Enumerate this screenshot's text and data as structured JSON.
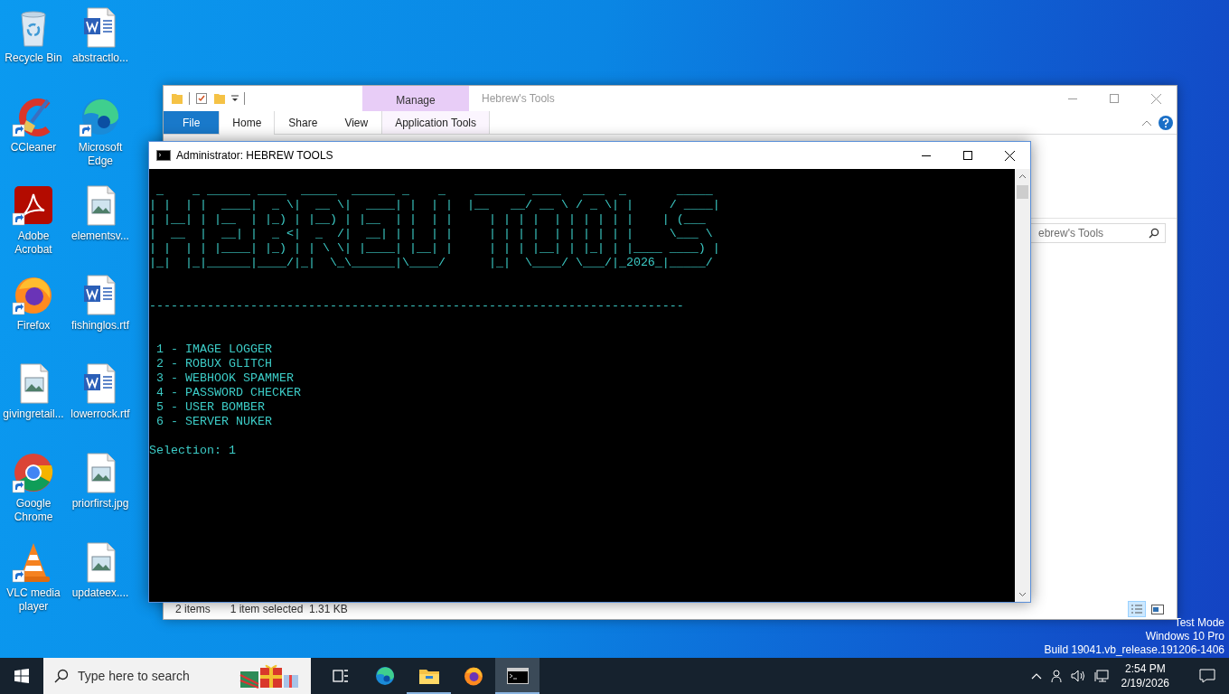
{
  "desktop": {
    "icons": [
      {
        "label": "Recycle Bin",
        "kind": "recycle",
        "shortcut": false
      },
      {
        "label": "abstractlo...",
        "kind": "word",
        "shortcut": false
      },
      {
        "label": "CCleaner",
        "kind": "ccleaner",
        "shortcut": true
      },
      {
        "label": "Microsoft Edge",
        "kind": "edge",
        "shortcut": true
      },
      {
        "label": "Adobe Acrobat",
        "kind": "acrobat",
        "shortcut": true
      },
      {
        "label": "elementsv...",
        "kind": "image",
        "shortcut": false
      },
      {
        "label": "Firefox",
        "kind": "firefox",
        "shortcut": true
      },
      {
        "label": "fishinglos.rtf",
        "kind": "word",
        "shortcut": false
      },
      {
        "label": "givingretail...",
        "kind": "image",
        "shortcut": false
      },
      {
        "label": "lowerrock.rtf",
        "kind": "word",
        "shortcut": false
      },
      {
        "label": "Google Chrome",
        "kind": "chrome",
        "shortcut": true
      },
      {
        "label": "priorfirst.jpg",
        "kind": "image",
        "shortcut": false
      },
      {
        "label": "VLC media player",
        "kind": "vlc",
        "shortcut": true
      },
      {
        "label": "updateex....",
        "kind": "image",
        "shortcut": false
      }
    ],
    "system_notice": [
      "Test Mode",
      "Windows 10 Pro",
      "Build 19041.vb_release.191206-1406"
    ]
  },
  "explorer": {
    "title": "Hebrew's Tools",
    "context_tab": "Manage",
    "tabs": [
      {
        "label": "File",
        "kind": "file",
        "selected": false
      },
      {
        "label": "Home",
        "kind": "tab",
        "selected": true
      },
      {
        "label": "Share",
        "kind": "tab",
        "selected": false
      },
      {
        "label": "View",
        "kind": "tab",
        "selected": false
      },
      {
        "label": "Application Tools",
        "kind": "context",
        "selected": false
      }
    ],
    "search_placeholder": "ebrew's Tools",
    "status_items": "2 items",
    "status_selection": "1 item selected  1.31 KB"
  },
  "console": {
    "title": "Administrator:  HEBREW TOOLS",
    "banner": [
      " _    _ ______ ____  _____  ______ _    _    _______ ____   ___  _       _____ ",
      "| |  | |  ____|  _ \\|  __ \\|  ____| |  | |  |__   __/ __ \\ / _ \\| |     / ____|",
      "| |__| | |__  | |_) | |__) | |__  | |  | |     | | | |  | | | | | |    | (___  ",
      "|  __  |  __| |  _ <|  _  /|  __| | |  | |     | | | |  | | | | | |     \\___ \\ ",
      "| |  | | |____| |_) | | \\ \\| |____| |__| |     | | | |__| | |_| | |____ ____) |",
      "|_|  |_|______|____/|_|  \\_\\______|\\____/      |_|  \\____/ \\___/|_2026_|_____/ "
    ],
    "rule": "--------------------------------------------------------------------------",
    "menu": [
      " 1 - IMAGE LOGGER",
      " 2 - ROBUX GLITCH",
      " 3 - WEBHOOK SPAMMER",
      " 4 - PASSWORD CHECKER",
      " 5 - USER BOMBER",
      " 6 - SERVER NUKER"
    ],
    "prompt": "Selection: 1"
  },
  "taskbar": {
    "search_placeholder": "Type here to search",
    "apps": [
      {
        "kind": "taskview",
        "running": false,
        "selected": false
      },
      {
        "kind": "edge",
        "running": false,
        "selected": false
      },
      {
        "kind": "explorer",
        "running": true,
        "selected": false
      },
      {
        "kind": "firefox",
        "running": false,
        "selected": false
      },
      {
        "kind": "terminal",
        "running": true,
        "selected": true
      }
    ],
    "time": "2:54 PM",
    "date": "2/19/2026"
  }
}
